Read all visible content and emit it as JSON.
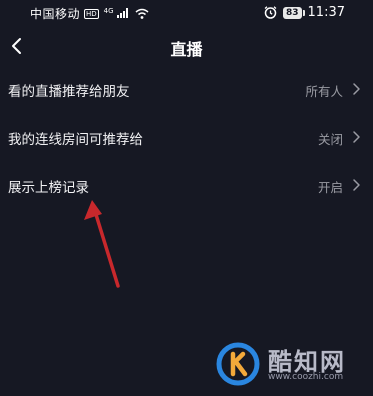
{
  "status_bar": {
    "carrier": "中国移动",
    "hd_badge": "HD",
    "network": "4G",
    "battery": "83",
    "time": "11:37"
  },
  "nav": {
    "title": "直播"
  },
  "settings": [
    {
      "label": "看的直播推荐给朋友",
      "value": "所有人"
    },
    {
      "label": "我的连线房间可推荐给",
      "value": "关闭"
    },
    {
      "label": "展示上榜记录",
      "value": "开启"
    }
  ],
  "icons": {
    "back": "chevron-left-icon",
    "row_arrow": "chevron-right-icon",
    "alarm": "alarm-clock-icon",
    "wifi": "wifi-icon",
    "signal": "signal-icon"
  },
  "colors": {
    "background": "#161823",
    "text": "#f2f2f4",
    "secondary_text": "#9a9ba3",
    "annotation_arrow": "#c8282c",
    "watermark_blue": "#2a86e0"
  },
  "watermark": {
    "name": "酷知网",
    "url": "www.coozhi.com"
  }
}
